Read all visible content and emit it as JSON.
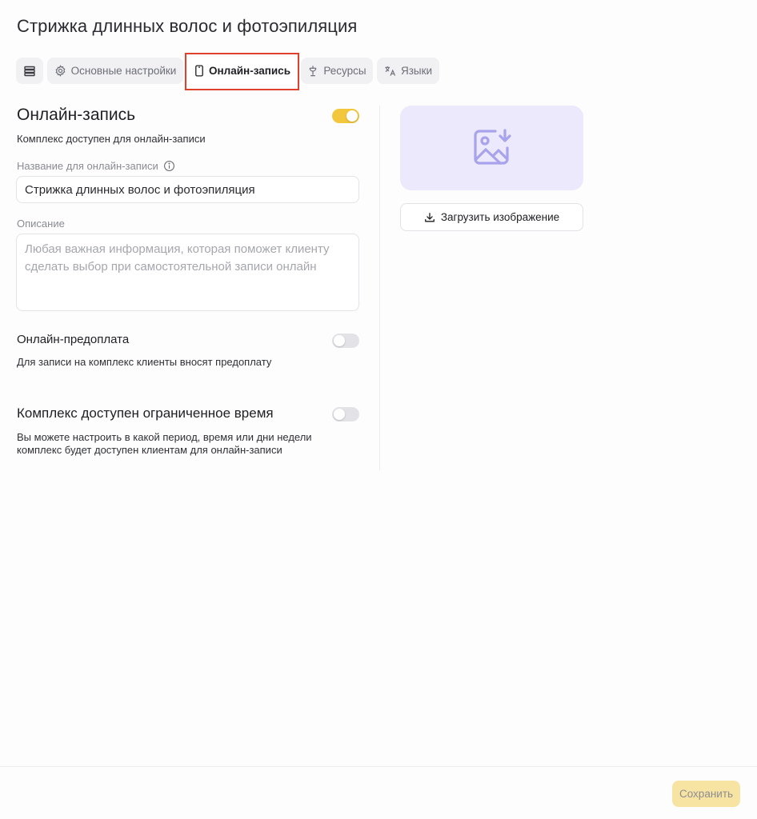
{
  "page": {
    "title": "Стрижка длинных волос и фотоэпиляция"
  },
  "tabs": [
    {
      "label": "Основные настройки",
      "icon": "gear-icon"
    },
    {
      "label": "Онлайн-запись",
      "icon": "phone-icon",
      "active": true
    },
    {
      "label": "Ресурсы",
      "icon": "resource-icon"
    },
    {
      "label": "Языки",
      "icon": "translate-icon"
    }
  ],
  "online": {
    "title": "Онлайн-запись",
    "available_text": "Комплекс доступен для онлайн-записи",
    "enabled": true,
    "name_label": "Название для онлайн-записи",
    "name_value": "Стрижка длинных волос и фотоэпиляция",
    "description_label": "Описание",
    "description_placeholder": "Любая важная информация, которая поможет клиенту сделать выбор при самостоятельной записи онлайн"
  },
  "prepay": {
    "title": "Онлайн-предоплата",
    "description": "Для записи на комплекс клиенты вносят предоплату",
    "enabled": false
  },
  "limited": {
    "title": "Комплекс доступен ограниченное время",
    "description_line1": "Вы можете настроить в какой период, время или дни недели",
    "description_line2": "комплекс будет доступен клиентам для онлайн-записи",
    "enabled": false
  },
  "image": {
    "upload_label": "Загрузить изображение"
  },
  "footer": {
    "save_label": "Сохранить"
  },
  "colors": {
    "accent": "#f3c73c",
    "save_disabled": "#f7e4a3",
    "image_bg": "#ebe9fb",
    "image_icon": "#a9a3ec",
    "highlight": "#e0412f"
  }
}
